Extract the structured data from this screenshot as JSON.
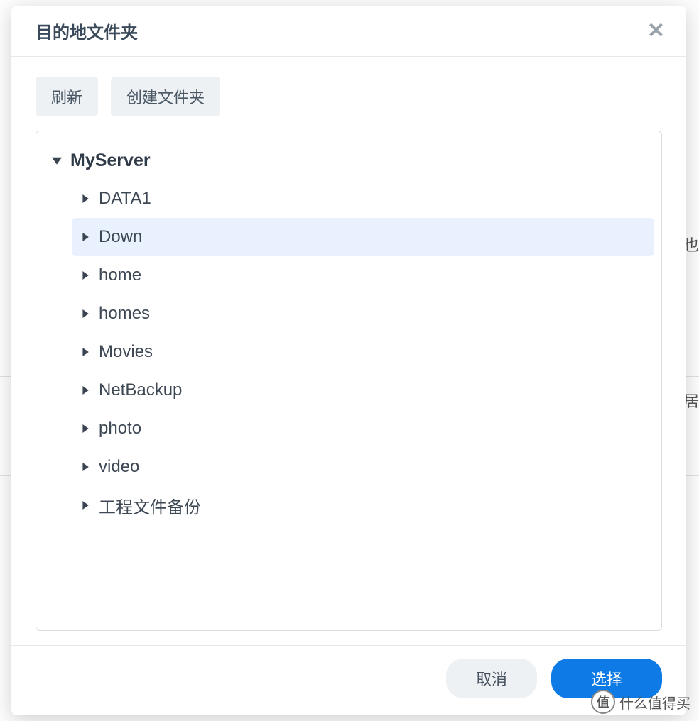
{
  "dialog": {
    "title": "目的地文件夹",
    "close_glyph": "✕"
  },
  "toolbar": {
    "refresh_label": "刷新",
    "create_folder_label": "创建文件夹"
  },
  "tree": {
    "root": {
      "label": "MyServer",
      "expanded": true,
      "children": [
        {
          "label": "DATA1",
          "selected": false
        },
        {
          "label": "Down",
          "selected": true
        },
        {
          "label": "home",
          "selected": false
        },
        {
          "label": "homes",
          "selected": false
        },
        {
          "label": "Movies",
          "selected": false
        },
        {
          "label": "NetBackup",
          "selected": false
        },
        {
          "label": "photo",
          "selected": false
        },
        {
          "label": "video",
          "selected": false
        },
        {
          "label": "工程文件备份",
          "selected": false
        }
      ]
    }
  },
  "footer": {
    "cancel_label": "取消",
    "select_label": "选择"
  },
  "background": {
    "text1": "也",
    "text2": "居"
  },
  "watermark": {
    "badge": "值",
    "text": "什么值得买"
  }
}
